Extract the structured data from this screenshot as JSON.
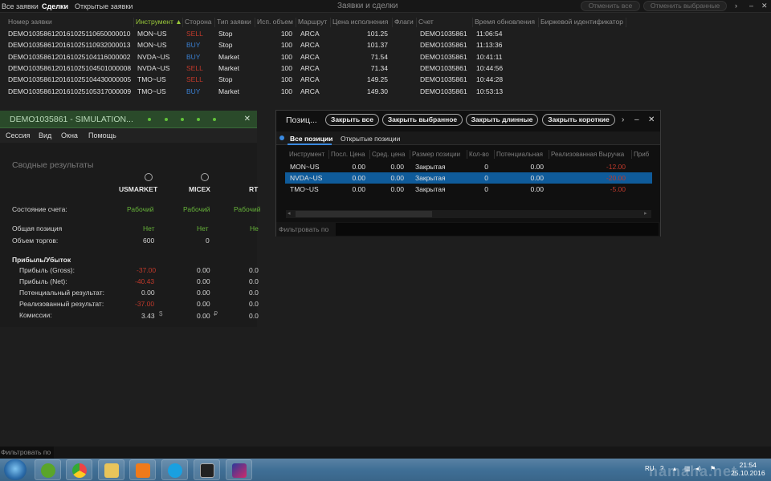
{
  "topbar": {
    "tabs": [
      "Все заявки",
      "Сделки",
      "Открытые заявки"
    ],
    "title": "Заявки и сделки",
    "cancel_all": "Отменить все",
    "cancel_selected": "Отменить выбранные"
  },
  "orders": {
    "headers": [
      "Номер заявки",
      "Инструмент ▲",
      "Сторона",
      "Тип заявки",
      "Исп. объем",
      "Маршрут",
      "Цена исполнения",
      "Флаги",
      "Счет",
      "Время обновления",
      "Биржевой идентификатор"
    ],
    "rows": [
      [
        "DEMO103586120161025110650000010",
        "MON~US",
        "SELL",
        "Stop",
        "100",
        "ARCA",
        "101.25",
        "",
        "DEMO1035861",
        "11:06:54",
        ""
      ],
      [
        "DEMO103586120161025110932000013",
        "MON~US",
        "BUY",
        "Stop",
        "100",
        "ARCA",
        "101.37",
        "",
        "DEMO1035861",
        "11:13:36",
        ""
      ],
      [
        "DEMO103586120161025104116000002",
        "NVDA~US",
        "BUY",
        "Market",
        "100",
        "ARCA",
        "71.54",
        "",
        "DEMO1035861",
        "10:41:11",
        ""
      ],
      [
        "DEMO103586120161025104501000008",
        "NVDA~US",
        "SELL",
        "Market",
        "100",
        "ARCA",
        "71.34",
        "",
        "DEMO1035861",
        "10:44:56",
        ""
      ],
      [
        "DEMO103586120161025104430000005",
        "TMO~US",
        "SELL",
        "Stop",
        "100",
        "ARCA",
        "149.25",
        "",
        "DEMO1035861",
        "10:44:28",
        ""
      ],
      [
        "DEMO103586120161025105317000009",
        "TMO~US",
        "BUY",
        "Market",
        "100",
        "ARCA",
        "149.30",
        "",
        "DEMO1035861",
        "10:53:13",
        ""
      ]
    ]
  },
  "sim": {
    "title": "DEMO1035861 - SIMULATION...",
    "title_extra": "Д и М С С",
    "menu": [
      "Сессия",
      "Вид",
      "Окна",
      "Помощь"
    ],
    "section": "Сводные результаты",
    "markets": [
      "USMARKET",
      "MICEX",
      "RT"
    ],
    "account_state_label": "Состояние счета:",
    "account_state": [
      "Рабочий",
      "Рабочий",
      "Рабочий"
    ],
    "total_position_label": "Общая позиция",
    "total_position": [
      "Нет",
      "Нет",
      "Не"
    ],
    "volume_label": "Объем торгов:",
    "volume": [
      "600",
      "0",
      ""
    ],
    "pnl_label": "Прибыль/Убыток",
    "gross_label": "Прибыль (Gross):",
    "gross": [
      "-37.00",
      "0.00",
      "0.0"
    ],
    "net_label": "Прибыль (Net):",
    "net": [
      "-40.43",
      "0.00",
      "0.0"
    ],
    "potential_label": "Потенциальный результат:",
    "potential": [
      "0.00",
      "0.00",
      "0.0"
    ],
    "realized_label": "Реализованный результат:",
    "realized": [
      "-37.00",
      "0.00",
      "0.0"
    ],
    "commission_label": "Комиссии:",
    "commission": [
      "3.43",
      "0.00",
      "0.0"
    ],
    "currency": [
      "$",
      "₽"
    ]
  },
  "positions": {
    "title": "Позиц...",
    "buttons": [
      "Закрыть все",
      "Закрыть выбранное",
      "Закрыть длинные",
      "Закрыть короткие"
    ],
    "more": "›",
    "tabs": [
      "Все позиции",
      "Открытые позиции"
    ],
    "headers": [
      "Инструмент",
      "Посл. Цена",
      "Сред. цена",
      "Размер позиции",
      "Кол-во",
      "Потенциальная",
      "Реализованная Выручка",
      "Приб"
    ],
    "rows": [
      [
        "MON~US",
        "0.00",
        "0.00",
        "Закрытая",
        "0",
        "0.00",
        "-12.00"
      ],
      [
        "NVDA~US",
        "0.00",
        "0.00",
        "Закрытая",
        "0",
        "0.00",
        "-20.00"
      ],
      [
        "TMO~US",
        "0.00",
        "0.00",
        "Закрытая",
        "0",
        "0.00",
        "-5.00"
      ]
    ],
    "filter_label": "Фильтровать по"
  },
  "bottom_filter": {
    "label": "Фильтровать по"
  },
  "taskbar": {
    "lang": "RU",
    "time": "21:54",
    "date": "25.10.2016",
    "watermark": "namaha.net"
  }
}
